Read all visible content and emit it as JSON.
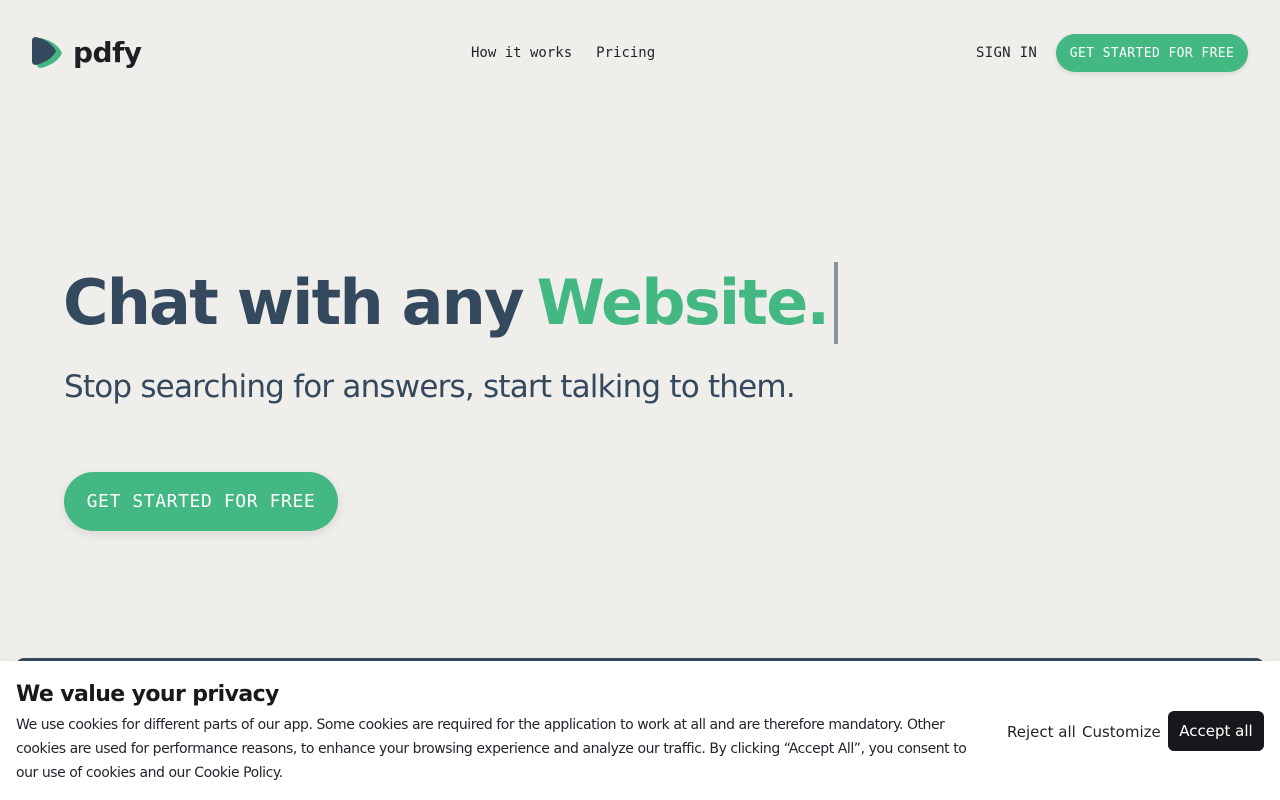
{
  "brand": {
    "name": "pdfy",
    "colors": {
      "accent": "#43b883",
      "dark": "#34495e",
      "background": "#f0eeea"
    }
  },
  "nav": {
    "links": [
      {
        "label": "How it works"
      },
      {
        "label": "Pricing"
      }
    ],
    "sign_in": "SIGN IN",
    "cta": "GET STARTED FOR FREE"
  },
  "hero": {
    "title_prefix": "Chat with any",
    "title_accent": "Website.",
    "subtitle": "Stop searching for answers, start talking to them.",
    "cta": "GET STARTED FOR FREE"
  },
  "cookie": {
    "title": "We value your privacy",
    "text": "We use cookies for different parts of our app. Some cookies are required for the application to work at all and are therefore mandatory. Other cookies are used for performance reasons, to enhance your browsing experience and analyze our traffic. By clicking “Accept All”, you consent to our use of cookies and our Cookie Policy.",
    "reject": "Reject all",
    "customize": "Customize",
    "accept": "Accept all"
  }
}
